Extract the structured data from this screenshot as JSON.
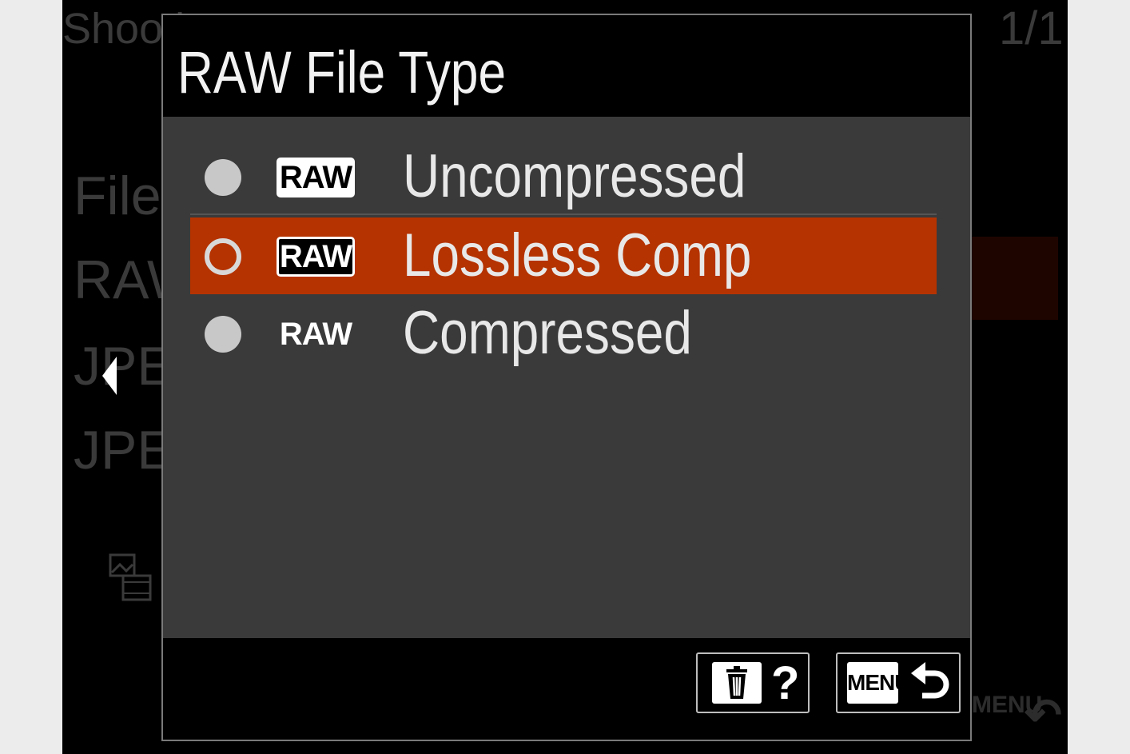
{
  "background_menu": {
    "header_text": "Shooti",
    "page_indicator": "1/1",
    "items": [
      "File",
      "RAW",
      "JPEG",
      "JPEG"
    ]
  },
  "dialog": {
    "title": "RAW File Type",
    "options": [
      {
        "icon_text": "RAW",
        "label": "Uncompressed",
        "selected": false
      },
      {
        "icon_text": "RAW",
        "label": "Lossless Comp",
        "selected": true
      },
      {
        "icon_text": "RAW",
        "label": "Compressed",
        "selected": false
      }
    ],
    "footer": {
      "help_symbol": "?",
      "menu_label": "MENU"
    }
  },
  "colors": {
    "selection": "#b53300",
    "body": "#3a3a3a",
    "frame": "#000000"
  },
  "icons": {
    "delete": "trash-icon",
    "back": "return-arrow-icon",
    "nav_left": "left-arrow-icon",
    "movie_still": "photo-film-icon"
  }
}
